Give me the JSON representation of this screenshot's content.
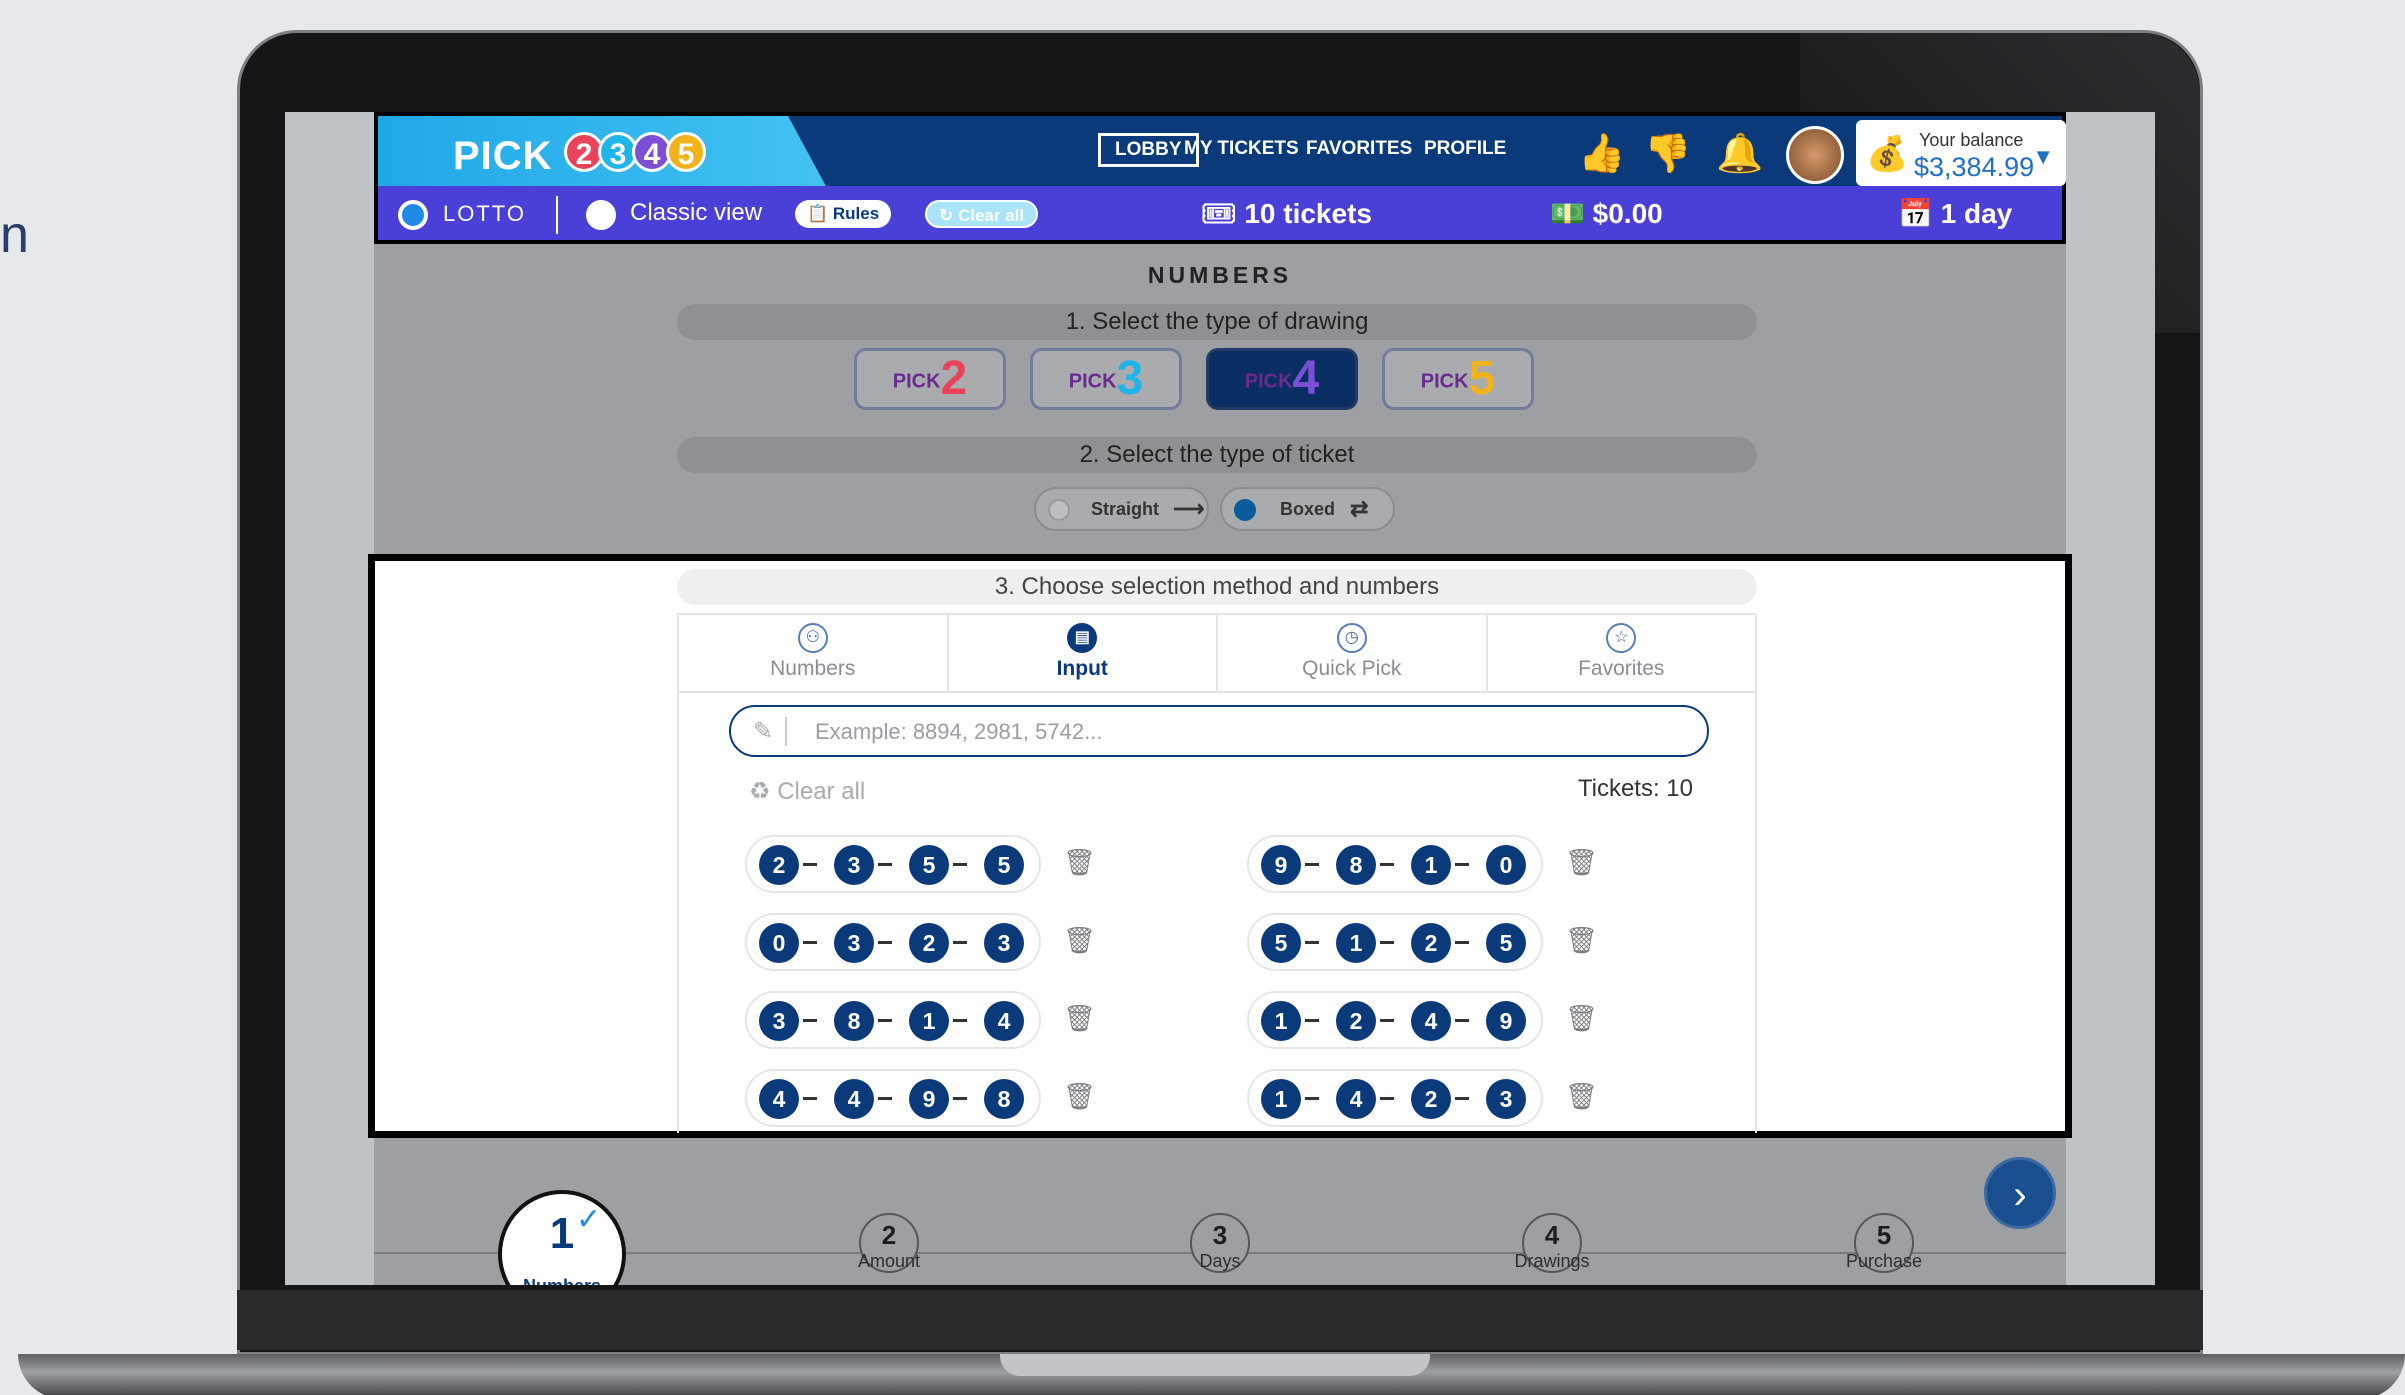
{
  "side": {
    "text": "n"
  },
  "header": {
    "logo": {
      "word": "PICK",
      "digits": [
        "2",
        "3",
        "4",
        "5"
      ],
      "digit_colors": [
        "#e8435a",
        "#1fb5e8",
        "#7b4fd6",
        "#f2b21b"
      ]
    },
    "nav": {
      "lobby": "LOBBY",
      "my_tickets": "MY TICKETS",
      "favorites": "FAVORITES",
      "profile": "PROFILE"
    },
    "balance": {
      "label": "Your balance",
      "value": "$3,384.99"
    }
  },
  "subbar": {
    "lotto_label": "LOTTO",
    "classic_view": "Classic view",
    "rules": "Rules",
    "clear_all": "Clear all",
    "tickets": "10 tickets",
    "amount": "$0.00",
    "days": "1 day"
  },
  "main": {
    "section_title": "NUMBERS",
    "step1": "1. Select the type of drawing",
    "draw_types": [
      {
        "pick": "PICK",
        "num": "2",
        "color": "#e8435a"
      },
      {
        "pick": "PICK",
        "num": "3",
        "color": "#1fb5e8"
      },
      {
        "pick": "PICK",
        "num": "4",
        "color": "#7b4fd6"
      },
      {
        "pick": "PICK",
        "num": "5",
        "color": "#f2b21b"
      }
    ],
    "selected_draw": "4",
    "step2": "2. Select the type of ticket",
    "ticket_types": {
      "straight": "Straight",
      "boxed": "Boxed"
    },
    "step3": "3. Choose selection method and numbers",
    "tabs": [
      "Numbers",
      "Input",
      "Quick Pick",
      "Favorites"
    ],
    "active_tab": "Input",
    "input_placeholder": "Example: 8894, 2981, 5742...",
    "clear_all": "Clear all",
    "tickets_count": "Tickets: 10",
    "tickets": [
      [
        "2",
        "3",
        "5",
        "5"
      ],
      [
        "9",
        "8",
        "1",
        "0"
      ],
      [
        "0",
        "3",
        "2",
        "3"
      ],
      [
        "5",
        "1",
        "2",
        "5"
      ],
      [
        "3",
        "8",
        "1",
        "4"
      ],
      [
        "1",
        "2",
        "4",
        "9"
      ],
      [
        "4",
        "4",
        "9",
        "8"
      ],
      [
        "1",
        "4",
        "2",
        "3"
      ]
    ]
  },
  "wizard": {
    "steps": [
      {
        "n": "1",
        "label": "Numbers"
      },
      {
        "n": "2",
        "label": "Amount"
      },
      {
        "n": "3",
        "label": "Days"
      },
      {
        "n": "4",
        "label": "Drawings"
      },
      {
        "n": "5",
        "label": "Purchase"
      }
    ],
    "active_step": "1"
  },
  "colors": {
    "brand_navy": "#0a3a7a",
    "subbar_purple": "#4a3fd6",
    "ball": "#0a3a7a"
  }
}
